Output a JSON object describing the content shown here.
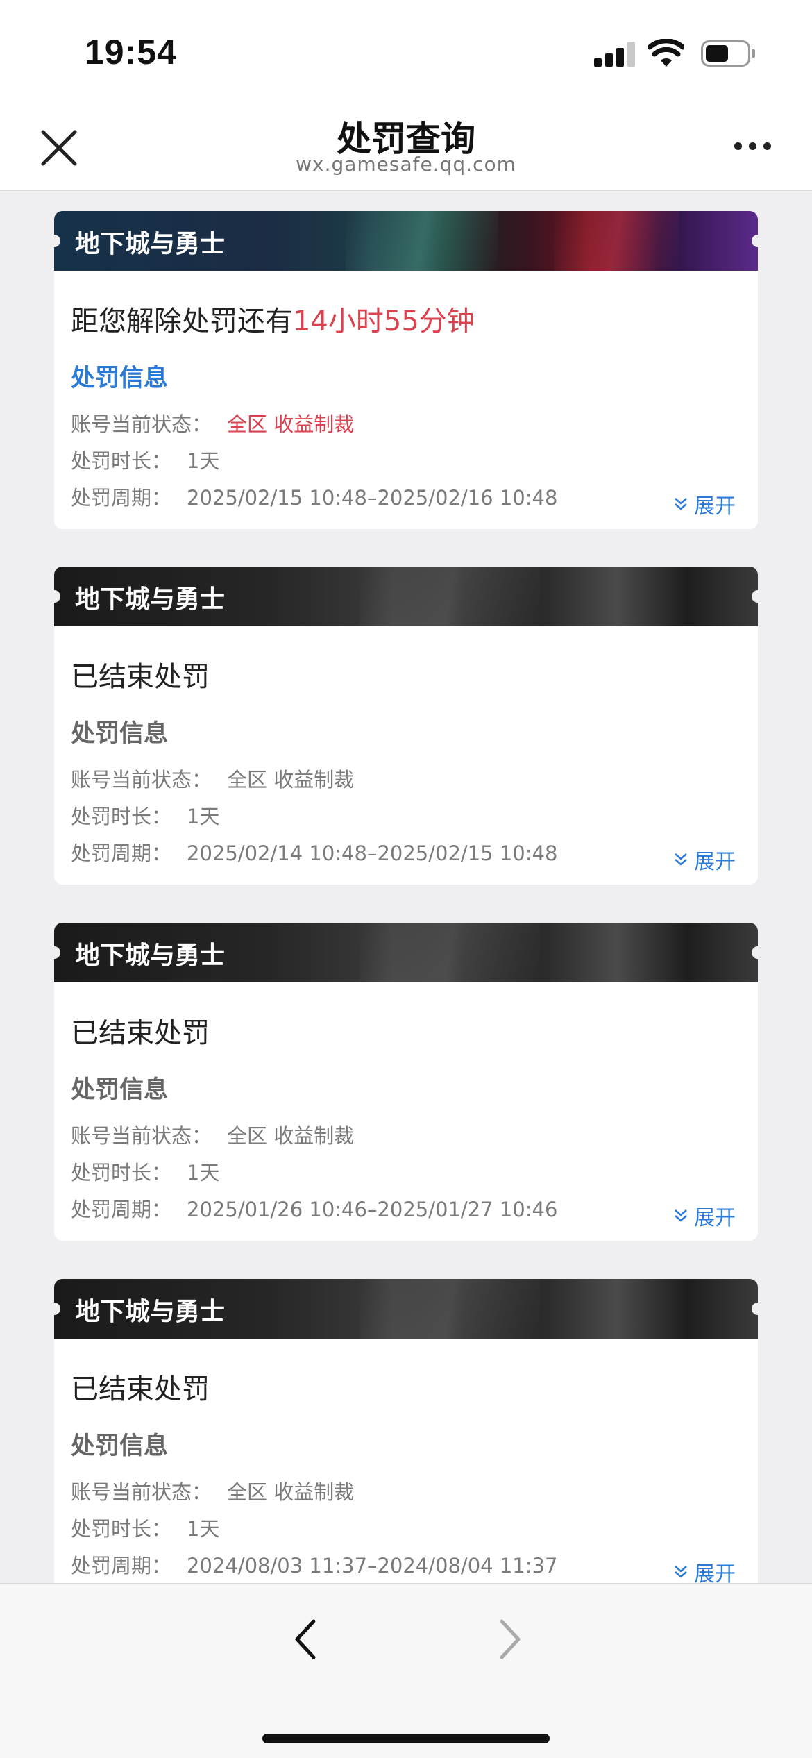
{
  "status_bar": {
    "time": "19:54"
  },
  "header": {
    "title": "处罚查询",
    "url": "wx.gamesafe.qq.com"
  },
  "cards": [
    {
      "game": "地下城与勇士",
      "headline_prefix": "距您解除处罚还有",
      "countdown": "14小时55分钟",
      "section": "处罚信息",
      "status_label": "账号当前状态：",
      "status_value": "全区 收益制裁",
      "duration_label": "处罚时长：",
      "duration_value": "1天",
      "period_label": "处罚周期：",
      "period_value": "2025/02/15 10:48–2025/02/16 10:48",
      "expand": "展开"
    },
    {
      "game": "地下城与勇士",
      "headline": "已结束处罚",
      "section": "处罚信息",
      "status_label": "账号当前状态：",
      "status_value": "全区 收益制裁",
      "duration_label": "处罚时长：",
      "duration_value": "1天",
      "period_label": "处罚周期：",
      "period_value": "2025/02/14 10:48–2025/02/15 10:48",
      "expand": "展开"
    },
    {
      "game": "地下城与勇士",
      "headline": "已结束处罚",
      "section": "处罚信息",
      "status_label": "账号当前状态：",
      "status_value": "全区 收益制裁",
      "duration_label": "处罚时长：",
      "duration_value": "1天",
      "period_label": "处罚周期：",
      "period_value": "2025/01/26 10:46–2025/01/27 10:46",
      "expand": "展开"
    },
    {
      "game": "地下城与勇士",
      "headline": "已结束处罚",
      "section": "处罚信息",
      "status_label": "账号当前状态：",
      "status_value": "全区 收益制裁",
      "duration_label": "处罚时长：",
      "duration_value": "1天",
      "period_label": "处罚周期：",
      "period_value": "2024/08/03 11:37–2024/08/04 11:37",
      "expand": "展开"
    }
  ],
  "colors": {
    "accent_blue": "#2a7ad5",
    "alert_red": "#d9434f"
  },
  "icons": [
    "close-icon",
    "more-icon",
    "signal-icon",
    "wifi-icon",
    "battery-icon",
    "double-chevron-down-icon",
    "back-arrow-icon",
    "forward-arrow-icon"
  ]
}
